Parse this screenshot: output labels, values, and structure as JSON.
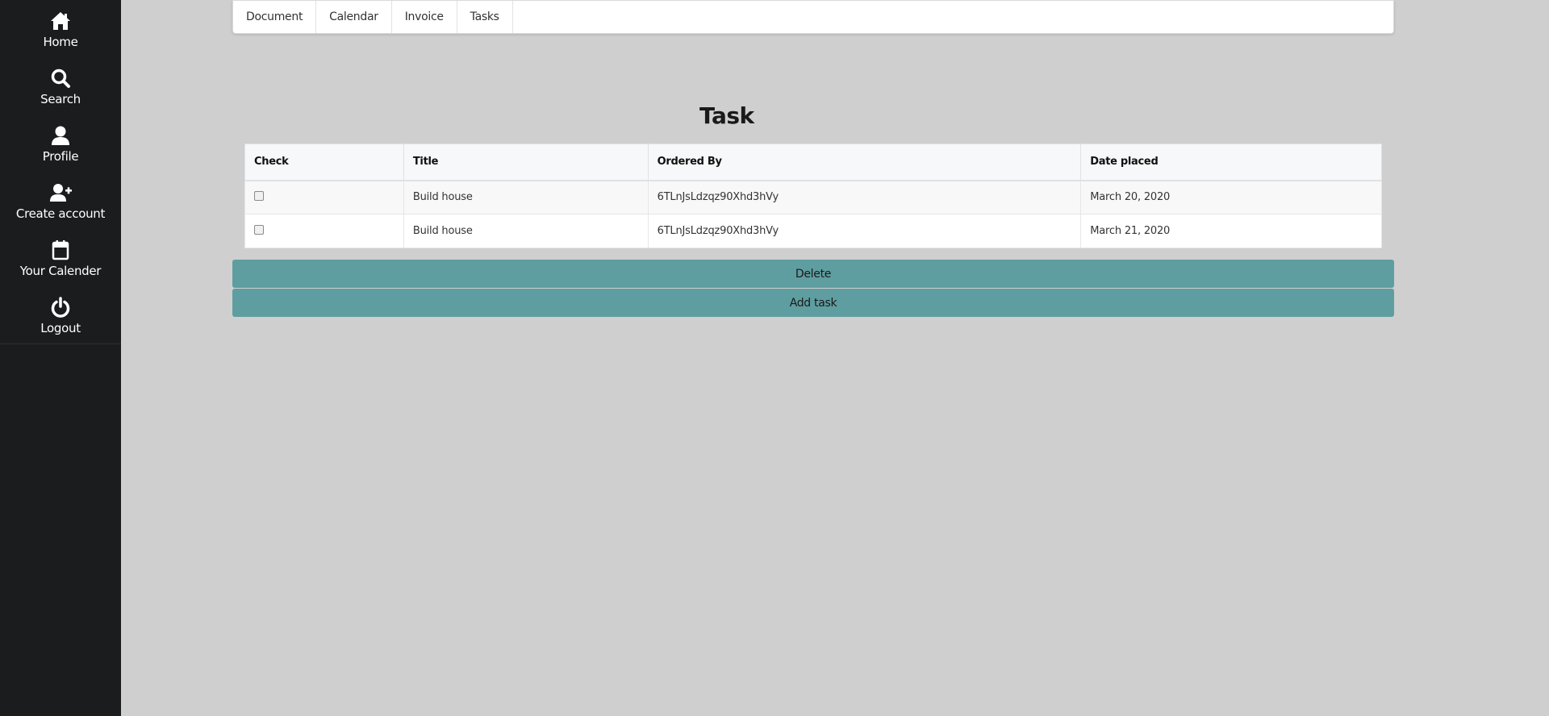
{
  "sidebar": {
    "items": [
      {
        "label": "Home",
        "icon": "home-icon"
      },
      {
        "label": "Search",
        "icon": "search-icon"
      },
      {
        "label": "Profile",
        "icon": "user-icon"
      },
      {
        "label": "Create account",
        "icon": "user-plus-icon"
      },
      {
        "label": "Your Calender",
        "icon": "calendar-icon"
      },
      {
        "label": "Logout",
        "icon": "power-icon"
      }
    ]
  },
  "topnav": {
    "tabs": [
      "Document",
      "Calendar",
      "Invoice",
      "Tasks"
    ]
  },
  "main": {
    "title": "Task",
    "table": {
      "headers": [
        "Check",
        "Title",
        "Ordered By",
        "Date placed"
      ],
      "rows": [
        {
          "checked": false,
          "title": "Build house",
          "ordered_by": "6TLnJsLdzqz90Xhd3hVy",
          "date": "March 20, 2020"
        },
        {
          "checked": false,
          "title": "Build house",
          "ordered_by": "6TLnJsLdzqz90Xhd3hVy",
          "date": "March 21, 2020"
        }
      ]
    },
    "delete_label": "Delete",
    "add_label": "Add task"
  },
  "colors": {
    "sidebar_bg": "#1b1c1e",
    "page_bg": "#cfcfcf",
    "button_bg": "#5f9ea0"
  }
}
